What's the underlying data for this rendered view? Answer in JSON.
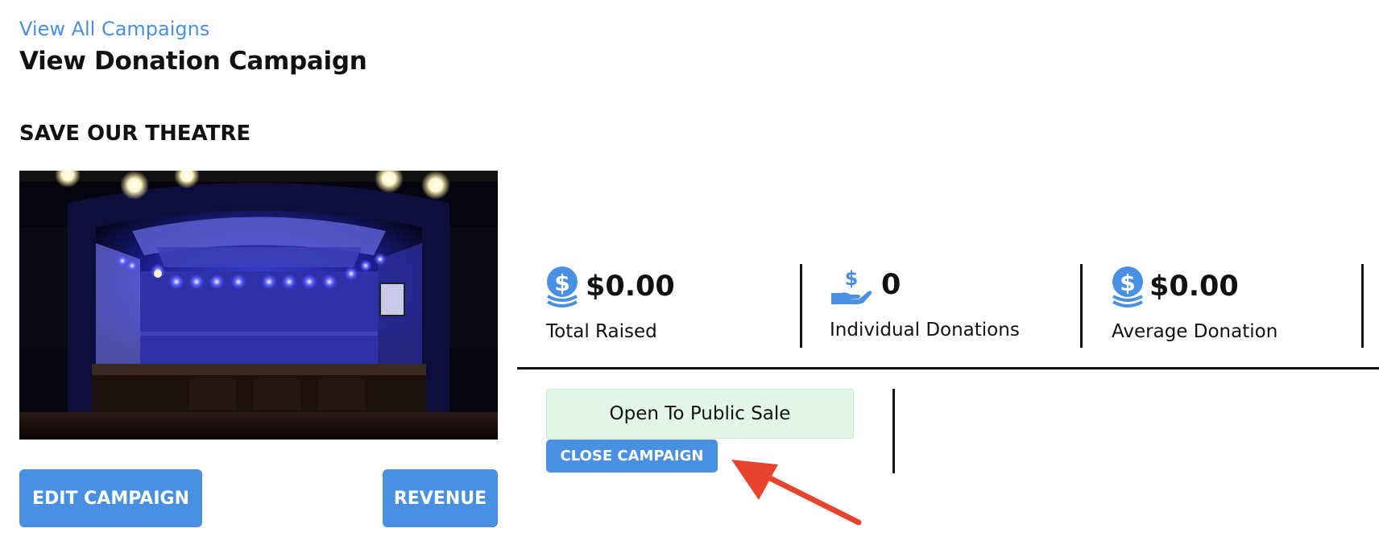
{
  "nav": {
    "back_link": "View All Campaigns"
  },
  "page": {
    "title": "View Donation Campaign"
  },
  "campaign": {
    "name": "SAVE OUR THEATRE",
    "image_alt": "Theatre stage with blue lights",
    "status": "Open To Public Sale"
  },
  "stats": {
    "total_raised": {
      "value": "$0.00",
      "label": "Total Raised",
      "icon": "coins-dollar-icon"
    },
    "individual_donations": {
      "value": "0",
      "label": "Individual Donations",
      "icon": "hand-dollar-icon"
    },
    "average_donation": {
      "value": "$0.00",
      "label": "Average Donation",
      "icon": "coins-dollar-icon"
    }
  },
  "actions": {
    "edit": "EDIT CAMPAIGN",
    "revenue": "REVENUE",
    "close": "CLOSE CAMPAIGN"
  },
  "colors": {
    "accent": "#4a90e2",
    "status_bg": "#e2f6e7",
    "annotation_arrow": "#e8432f"
  }
}
